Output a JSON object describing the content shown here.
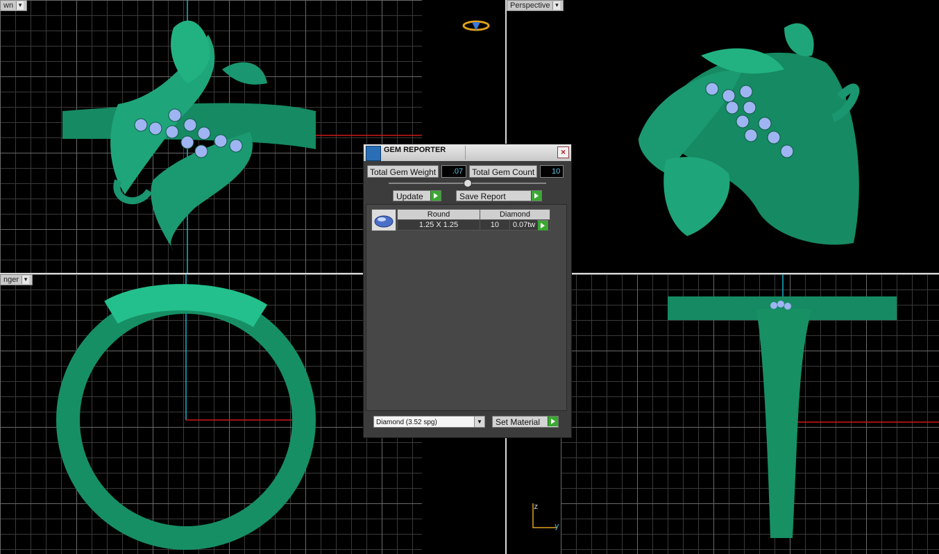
{
  "viewports": {
    "top_left": {
      "label": "wn"
    },
    "top_right": {
      "label": "Perspective"
    },
    "bottom_left": {
      "label": "nger"
    }
  },
  "gem_reporter": {
    "title": "GEM REPORTER",
    "close_glyph": "×",
    "total_weight_label": "Total Gem Weight",
    "total_weight_value": ".07",
    "total_count_label": "Total Gem Count",
    "total_count_value": "10",
    "update_label": "Update",
    "save_report_label": "Save Report",
    "gems": [
      {
        "shape": "Round",
        "size": "1.25 X 1.25",
        "material": "Diamond",
        "count": "10",
        "weight": "0.07tw"
      }
    ],
    "material_select": "Diamond    (3.52 spg)",
    "set_material_label": "Set Material"
  },
  "axes": {
    "z": "z",
    "y": "y"
  },
  "colors": {
    "ring": "#1a8f68",
    "gem": "#9fb4f2",
    "axis_red": "#d01818",
    "axis_cyan": "#1ab3c9"
  }
}
